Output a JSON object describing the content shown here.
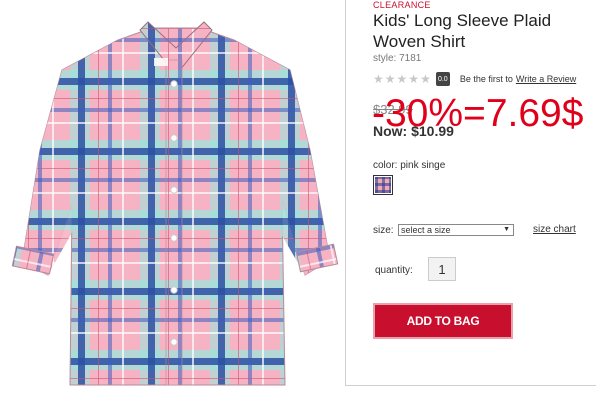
{
  "product": {
    "badge": "CLEARANCE",
    "title": "Kids' Long Sleeve Plaid Woven Shirt",
    "style": "style: 7181",
    "image_alt": "pink plaid long sleeve shirt",
    "rating": {
      "stars": 0,
      "stars_max": 5,
      "score": "0.0",
      "prompt": "Be the first to",
      "link": "Write a Review"
    },
    "price": {
      "old": "$32.99",
      "now": "Now: $10.99",
      "overlay": "-30%=7.69$"
    },
    "color": {
      "label": "color: pink singe",
      "swatch": "pink-plaid"
    },
    "size": {
      "label": "size:",
      "selected": "select a size",
      "chart_link": "size chart"
    },
    "quantity": {
      "label": "quantity:",
      "value": "1"
    },
    "add_to_bag": "ADD TO BAG"
  },
  "colors": {
    "accent": "#c8102e",
    "overlay_red": "#e0001b",
    "shirt_pink": "#f4a7b9",
    "plaid_blue": "#2a4fa0",
    "plaid_aqua": "#8ee0d8"
  }
}
